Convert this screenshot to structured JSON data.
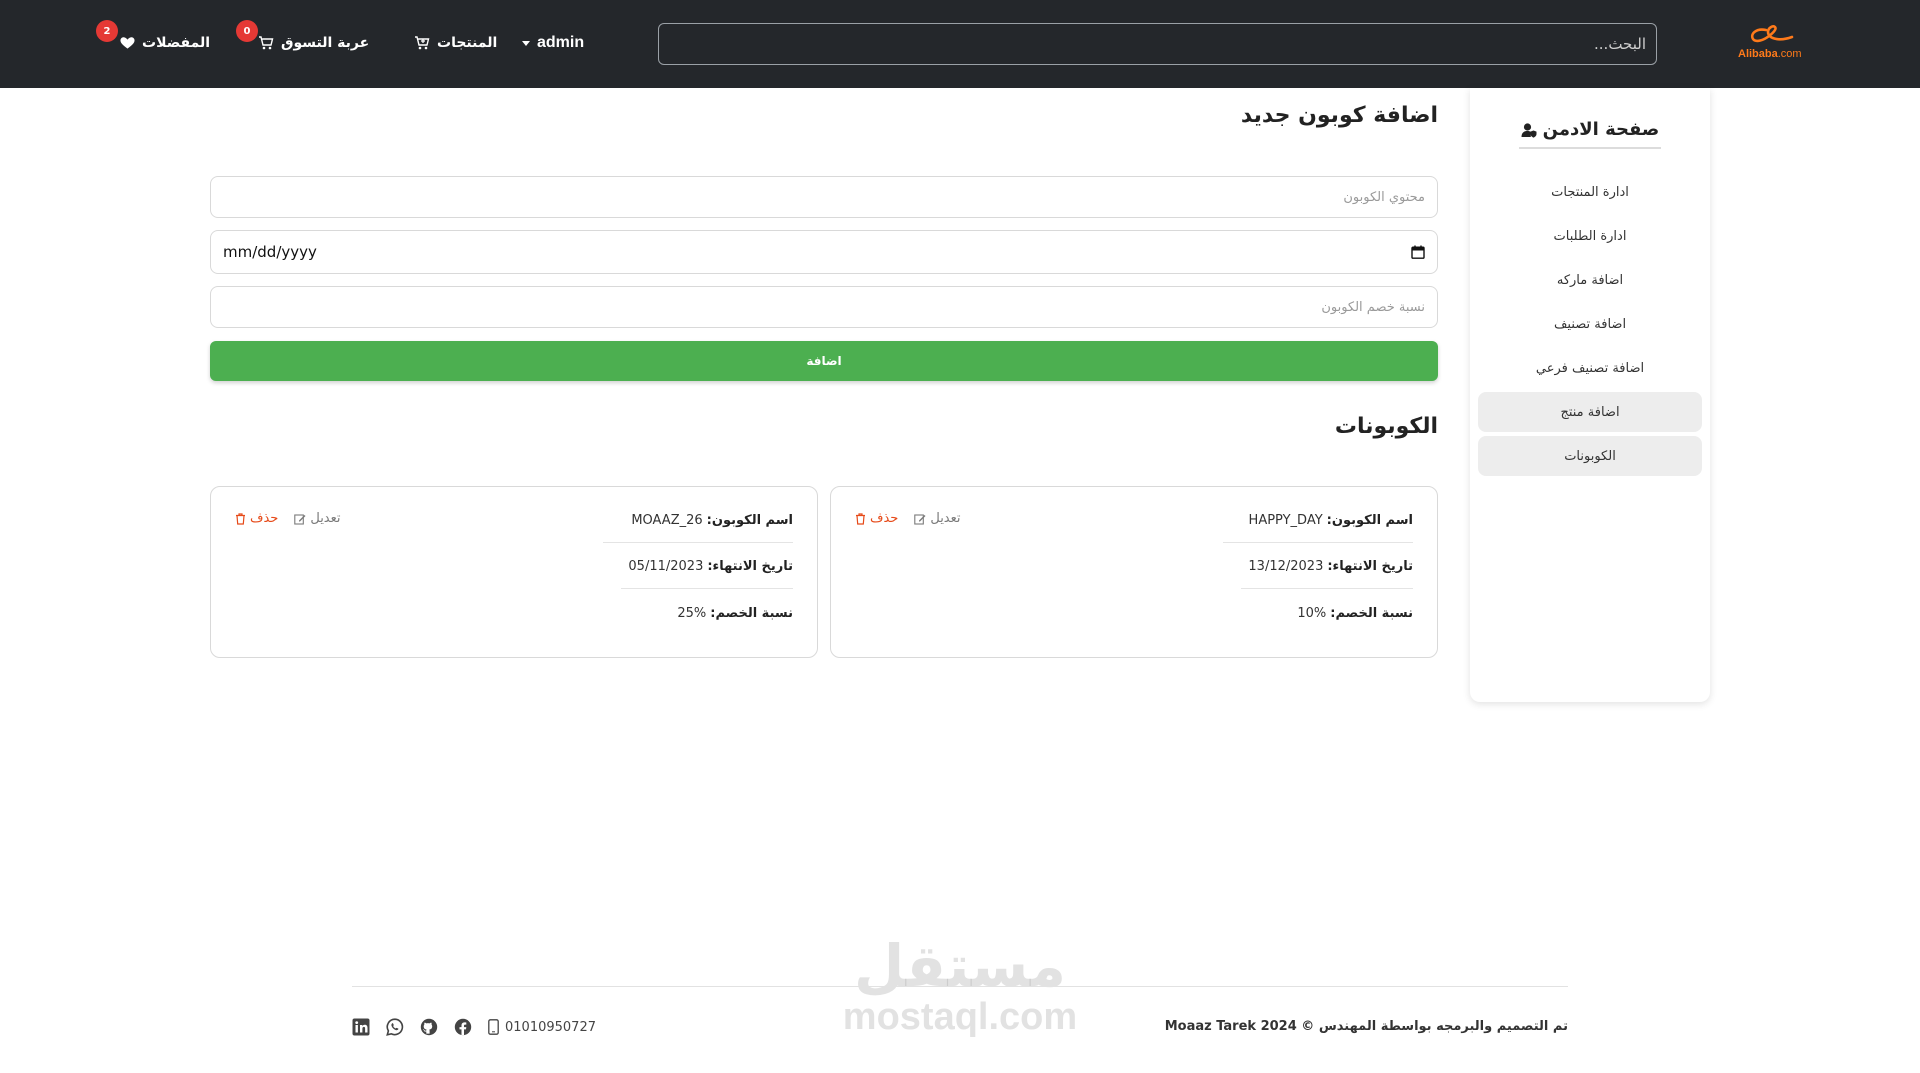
{
  "brand": {
    "logo_text": "Alibaba",
    "logo_suffix": ".com"
  },
  "header": {
    "search_placeholder": "البحث...",
    "admin_label": "admin",
    "products_label": "المنتجات",
    "cart_label": "عربة التسوق",
    "cart_count": "0",
    "favorites_label": "المفضلات",
    "favorites_count": "2"
  },
  "sidebar": {
    "title": "صفحة الادمن",
    "items": [
      {
        "label": "ادارة المنتجات"
      },
      {
        "label": "ادارة الطلبات"
      },
      {
        "label": "اضافة ماركه"
      },
      {
        "label": "اضافة تصنيف"
      },
      {
        "label": "اضافة تصنيف فرعي"
      },
      {
        "label": "اضافة منتج"
      },
      {
        "label": "الكوبونات"
      }
    ]
  },
  "form": {
    "title": "اضافة كوبون جديد",
    "coupon_name_placeholder": "محتوي الكوبون",
    "date_placeholder": "mm/dd/yyyy",
    "discount_placeholder": "نسبة خصم الكوبون",
    "submit_label": "اضافة"
  },
  "coupons": {
    "title": "الكوبونات",
    "name_key": "اسم الكوبون:",
    "expiry_key": "تاريخ الانتهاء:",
    "discount_key": "نسبة الخصم:",
    "edit_label": "تعديل",
    "delete_label": "حذف",
    "items": [
      {
        "name": "HAPPY_DAY",
        "expiry": "13/12/2023",
        "discount": "10%"
      },
      {
        "name": "MOAAZ_26",
        "expiry": "05/11/2023",
        "discount": "25%"
      }
    ]
  },
  "footer": {
    "credit": "تم التصميم والبرمجه بواسطة المهندس © Moaaz Tarek 2024",
    "phone": "01010950727",
    "social_icons": [
      "facebook-icon",
      "github-icon",
      "whatsapp-icon",
      "linkedin-icon"
    ]
  },
  "watermark": {
    "arabic": "مستقل",
    "latin": "mostaql.com"
  },
  "colors": {
    "navbar": "#24272b",
    "accent_green": "#4caf50",
    "badge_red": "#e53935",
    "delete_orange": "#e64a19",
    "logo_orange": "#ff7a1a"
  }
}
